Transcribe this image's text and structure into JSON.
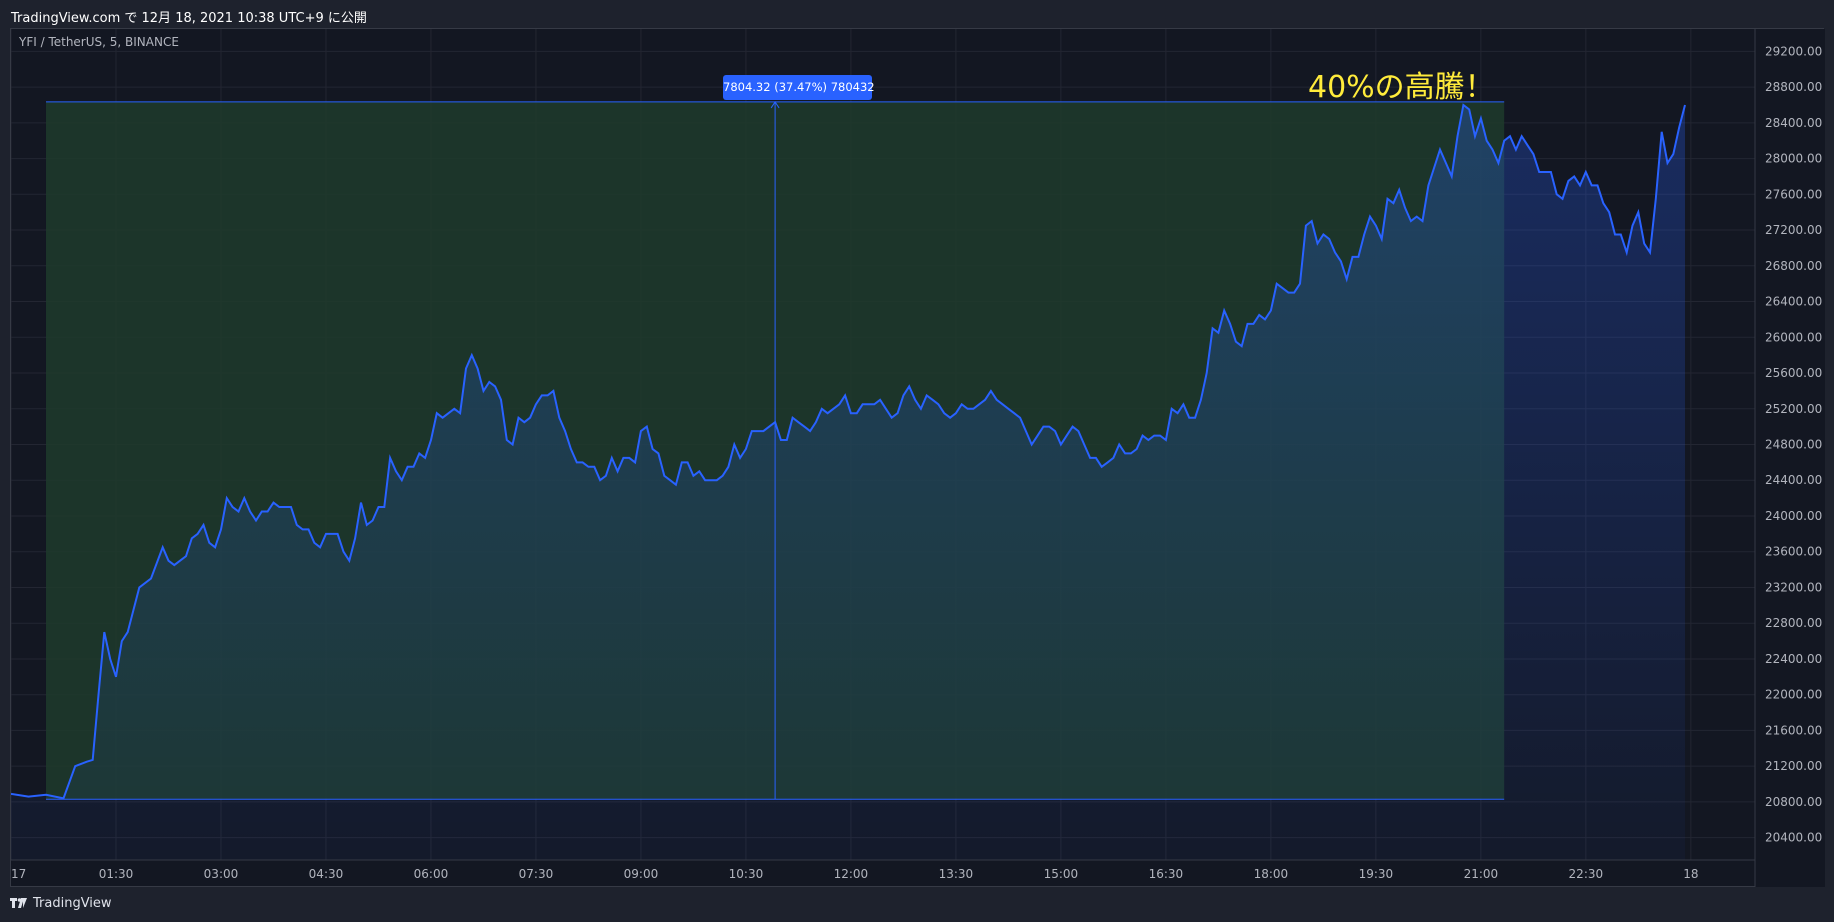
{
  "header": {
    "published_text": "TradingView.com で 12月 18, 2021 10:38 UTC+9 に公開"
  },
  "footer": {
    "logo_text": "TradingView"
  },
  "colors": {
    "background": "#131722",
    "line": "#2962ff",
    "measure_fill": "#1f3b2b",
    "annotation": "#ffeb3b",
    "grid": "#232632"
  },
  "chart_data": {
    "type": "area",
    "title": "YFI / TetherUS, 5, BINANCE",
    "annotation_text": "40%の高騰！",
    "measure_label": "7804.32 (37.47%) 780432",
    "measure_range": {
      "from_price": 20830,
      "to_price": 28634,
      "from_time": "00:30",
      "to_time": "21:20"
    },
    "ylim": [
      20150,
      29450
    ],
    "yticks": [
      20400,
      20800,
      21200,
      21600,
      22000,
      22400,
      22800,
      23200,
      23600,
      24000,
      24400,
      24800,
      25200,
      25600,
      26000,
      26400,
      26800,
      27200,
      27600,
      28000,
      28400,
      28800,
      29200
    ],
    "xlim_minutes": [
      0,
      1495
    ],
    "xticks": [
      {
        "label": "17",
        "min": 0
      },
      {
        "label": "01:30",
        "min": 90
      },
      {
        "label": "03:00",
        "min": 180
      },
      {
        "label": "04:30",
        "min": 270
      },
      {
        "label": "06:00",
        "min": 360
      },
      {
        "label": "07:30",
        "min": 450
      },
      {
        "label": "09:00",
        "min": 540
      },
      {
        "label": "10:30",
        "min": 630
      },
      {
        "label": "12:00",
        "min": 720
      },
      {
        "label": "13:30",
        "min": 810
      },
      {
        "label": "15:00",
        "min": 900
      },
      {
        "label": "16:30",
        "min": 990
      },
      {
        "label": "18:00",
        "min": 1080
      },
      {
        "label": "19:30",
        "min": 1170
      },
      {
        "label": "21:00",
        "min": 1260
      },
      {
        "label": "22:30",
        "min": 1350
      },
      {
        "label": "18",
        "min": 1440
      }
    ],
    "series": [
      {
        "points": [
          [
            0,
            20890
          ],
          [
            15,
            20860
          ],
          [
            30,
            20880
          ],
          [
            45,
            20840
          ],
          [
            55,
            21200
          ],
          [
            65,
            21250
          ],
          [
            70,
            21270
          ],
          [
            75,
            22000
          ],
          [
            80,
            22700
          ],
          [
            85,
            22400
          ],
          [
            90,
            22200
          ],
          [
            95,
            22600
          ],
          [
            100,
            22700
          ],
          [
            110,
            23200
          ],
          [
            120,
            23300
          ],
          [
            130,
            23650
          ],
          [
            135,
            23500
          ],
          [
            140,
            23450
          ],
          [
            150,
            23550
          ],
          [
            155,
            23750
          ],
          [
            160,
            23800
          ],
          [
            165,
            23900
          ],
          [
            170,
            23700
          ],
          [
            175,
            23650
          ],
          [
            180,
            23850
          ],
          [
            185,
            24200
          ],
          [
            190,
            24100
          ],
          [
            195,
            24050
          ],
          [
            200,
            24200
          ],
          [
            205,
            24050
          ],
          [
            210,
            23950
          ],
          [
            215,
            24050
          ],
          [
            220,
            24050
          ],
          [
            225,
            24150
          ],
          [
            230,
            24100
          ],
          [
            240,
            24100
          ],
          [
            245,
            23900
          ],
          [
            250,
            23850
          ],
          [
            255,
            23850
          ],
          [
            260,
            23700
          ],
          [
            265,
            23650
          ],
          [
            270,
            23800
          ],
          [
            280,
            23800
          ],
          [
            285,
            23600
          ],
          [
            290,
            23500
          ],
          [
            295,
            23750
          ],
          [
            300,
            24150
          ],
          [
            305,
            23900
          ],
          [
            310,
            23950
          ],
          [
            315,
            24100
          ],
          [
            320,
            24100
          ],
          [
            325,
            24650
          ],
          [
            330,
            24500
          ],
          [
            335,
            24400
          ],
          [
            340,
            24550
          ],
          [
            345,
            24550
          ],
          [
            350,
            24700
          ],
          [
            355,
            24650
          ],
          [
            360,
            24850
          ],
          [
            365,
            25150
          ],
          [
            370,
            25100
          ],
          [
            375,
            25150
          ],
          [
            380,
            25200
          ],
          [
            385,
            25150
          ],
          [
            390,
            25650
          ],
          [
            395,
            25800
          ],
          [
            400,
            25650
          ],
          [
            405,
            25400
          ],
          [
            410,
            25500
          ],
          [
            415,
            25450
          ],
          [
            420,
            25300
          ],
          [
            425,
            24850
          ],
          [
            430,
            24800
          ],
          [
            435,
            25100
          ],
          [
            440,
            25050
          ],
          [
            445,
            25100
          ],
          [
            450,
            25250
          ],
          [
            455,
            25350
          ],
          [
            460,
            25350
          ],
          [
            465,
            25400
          ],
          [
            470,
            25100
          ],
          [
            475,
            24950
          ],
          [
            480,
            24750
          ],
          [
            485,
            24600
          ],
          [
            490,
            24600
          ],
          [
            495,
            24550
          ],
          [
            500,
            24550
          ],
          [
            505,
            24400
          ],
          [
            510,
            24450
          ],
          [
            515,
            24650
          ],
          [
            520,
            24500
          ],
          [
            525,
            24650
          ],
          [
            530,
            24650
          ],
          [
            535,
            24600
          ],
          [
            540,
            24950
          ],
          [
            545,
            25000
          ],
          [
            550,
            24750
          ],
          [
            555,
            24700
          ],
          [
            560,
            24450
          ],
          [
            565,
            24400
          ],
          [
            570,
            24350
          ],
          [
            575,
            24600
          ],
          [
            580,
            24600
          ],
          [
            585,
            24450
          ],
          [
            590,
            24500
          ],
          [
            595,
            24400
          ],
          [
            600,
            24400
          ],
          [
            605,
            24400
          ],
          [
            610,
            24450
          ],
          [
            615,
            24550
          ],
          [
            620,
            24800
          ],
          [
            625,
            24650
          ],
          [
            630,
            24750
          ],
          [
            635,
            24950
          ],
          [
            640,
            24950
          ],
          [
            645,
            24950
          ],
          [
            650,
            25000
          ],
          [
            655,
            25050
          ],
          [
            660,
            24850
          ],
          [
            665,
            24850
          ],
          [
            670,
            25100
          ],
          [
            675,
            25050
          ],
          [
            680,
            25000
          ],
          [
            685,
            24950
          ],
          [
            690,
            25050
          ],
          [
            695,
            25200
          ],
          [
            700,
            25150
          ],
          [
            705,
            25200
          ],
          [
            710,
            25250
          ],
          [
            715,
            25350
          ],
          [
            720,
            25150
          ],
          [
            725,
            25150
          ],
          [
            730,
            25250
          ],
          [
            735,
            25250
          ],
          [
            740,
            25250
          ],
          [
            745,
            25300
          ],
          [
            750,
            25200
          ],
          [
            755,
            25100
          ],
          [
            760,
            25150
          ],
          [
            765,
            25350
          ],
          [
            770,
            25450
          ],
          [
            775,
            25300
          ],
          [
            780,
            25200
          ],
          [
            785,
            25350
          ],
          [
            790,
            25300
          ],
          [
            795,
            25250
          ],
          [
            800,
            25150
          ],
          [
            805,
            25100
          ],
          [
            810,
            25150
          ],
          [
            815,
            25250
          ],
          [
            820,
            25200
          ],
          [
            825,
            25200
          ],
          [
            830,
            25250
          ],
          [
            835,
            25300
          ],
          [
            840,
            25400
          ],
          [
            845,
            25300
          ],
          [
            850,
            25250
          ],
          [
            855,
            25200
          ],
          [
            860,
            25150
          ],
          [
            865,
            25100
          ],
          [
            870,
            24950
          ],
          [
            875,
            24800
          ],
          [
            880,
            24900
          ],
          [
            885,
            25000
          ],
          [
            890,
            25000
          ],
          [
            895,
            24950
          ],
          [
            900,
            24800
          ],
          [
            905,
            24900
          ],
          [
            910,
            25000
          ],
          [
            915,
            24950
          ],
          [
            920,
            24800
          ],
          [
            925,
            24650
          ],
          [
            930,
            24650
          ],
          [
            935,
            24550
          ],
          [
            940,
            24600
          ],
          [
            945,
            24650
          ],
          [
            950,
            24800
          ],
          [
            955,
            24700
          ],
          [
            960,
            24700
          ],
          [
            965,
            24750
          ],
          [
            970,
            24900
          ],
          [
            975,
            24850
          ],
          [
            980,
            24900
          ],
          [
            985,
            24900
          ],
          [
            990,
            24850
          ],
          [
            995,
            25200
          ],
          [
            1000,
            25150
          ],
          [
            1005,
            25250
          ],
          [
            1010,
            25100
          ],
          [
            1015,
            25100
          ],
          [
            1020,
            25300
          ],
          [
            1025,
            25600
          ],
          [
            1030,
            26100
          ],
          [
            1035,
            26050
          ],
          [
            1040,
            26300
          ],
          [
            1045,
            26150
          ],
          [
            1050,
            25950
          ],
          [
            1055,
            25900
          ],
          [
            1060,
            26150
          ],
          [
            1065,
            26150
          ],
          [
            1070,
            26250
          ],
          [
            1075,
            26200
          ],
          [
            1080,
            26300
          ],
          [
            1085,
            26600
          ],
          [
            1090,
            26550
          ],
          [
            1095,
            26500
          ],
          [
            1100,
            26500
          ],
          [
            1105,
            26600
          ],
          [
            1110,
            27250
          ],
          [
            1115,
            27300
          ],
          [
            1120,
            27050
          ],
          [
            1125,
            27150
          ],
          [
            1130,
            27100
          ],
          [
            1135,
            26950
          ],
          [
            1140,
            26850
          ],
          [
            1145,
            26650
          ],
          [
            1150,
            26900
          ],
          [
            1155,
            26900
          ],
          [
            1160,
            27150
          ],
          [
            1165,
            27350
          ],
          [
            1170,
            27250
          ],
          [
            1175,
            27100
          ],
          [
            1180,
            27550
          ],
          [
            1185,
            27500
          ],
          [
            1190,
            27650
          ],
          [
            1195,
            27450
          ],
          [
            1200,
            27300
          ],
          [
            1205,
            27350
          ],
          [
            1210,
            27300
          ],
          [
            1215,
            27700
          ],
          [
            1220,
            27900
          ],
          [
            1225,
            28100
          ],
          [
            1230,
            27950
          ],
          [
            1235,
            27800
          ],
          [
            1240,
            28250
          ],
          [
            1245,
            28600
          ],
          [
            1250,
            28550
          ],
          [
            1255,
            28250
          ],
          [
            1260,
            28450
          ],
          [
            1265,
            28200
          ],
          [
            1270,
            28100
          ],
          [
            1275,
            27950
          ],
          [
            1280,
            28200
          ],
          [
            1285,
            28250
          ],
          [
            1290,
            28100
          ],
          [
            1295,
            28250
          ],
          [
            1300,
            28150
          ],
          [
            1305,
            28050
          ],
          [
            1310,
            27850
          ],
          [
            1315,
            27850
          ],
          [
            1320,
            27850
          ],
          [
            1325,
            27600
          ],
          [
            1330,
            27550
          ],
          [
            1335,
            27750
          ],
          [
            1340,
            27800
          ],
          [
            1345,
            27700
          ],
          [
            1350,
            27850
          ],
          [
            1355,
            27700
          ],
          [
            1360,
            27700
          ],
          [
            1365,
            27500
          ],
          [
            1370,
            27400
          ],
          [
            1375,
            27150
          ],
          [
            1380,
            27150
          ],
          [
            1385,
            26950
          ],
          [
            1390,
            27250
          ],
          [
            1395,
            27400
          ],
          [
            1400,
            27050
          ],
          [
            1405,
            26950
          ],
          [
            1410,
            27550
          ],
          [
            1415,
            28300
          ],
          [
            1420,
            27950
          ],
          [
            1425,
            28050
          ],
          [
            1430,
            28350
          ],
          [
            1435,
            28600
          ]
        ]
      }
    ]
  }
}
